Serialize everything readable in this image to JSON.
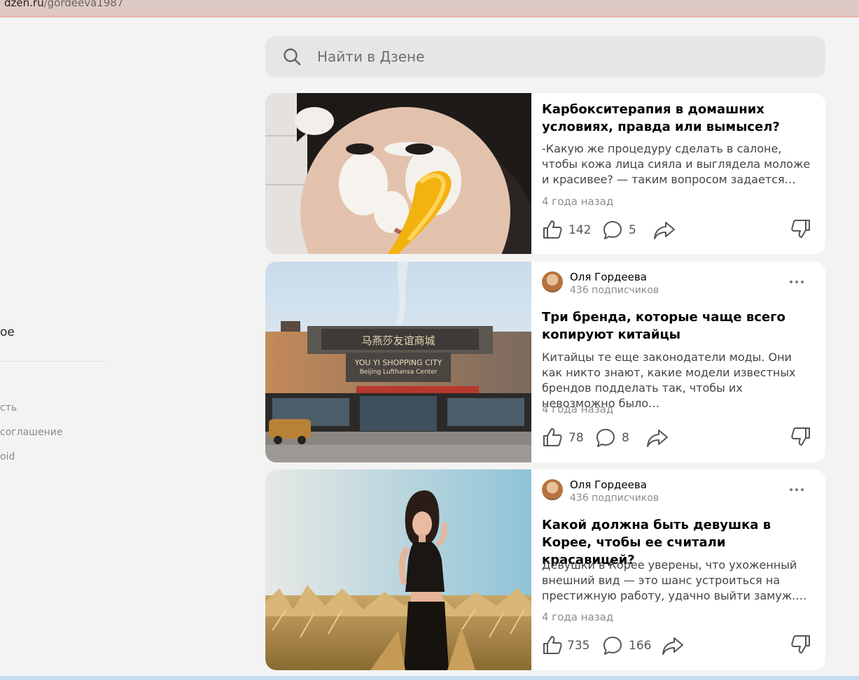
{
  "browser": {
    "url_host": "dzen.ru",
    "url_path": "/gordeeva1987"
  },
  "sidebar": {
    "items": [
      {
        "label": "ое"
      }
    ],
    "footer_links": [
      {
        "label": "сть"
      },
      {
        "label": "соглашение"
      },
      {
        "label": "oid"
      }
    ]
  },
  "search": {
    "placeholder": "Найти в Дзене"
  },
  "feed": [
    {
      "title": "Карбокситерапия в домашних условиях, правда или вымысел?",
      "snippet": "-Какую же процедуру сделать в салоне, чтобы кожа лица сияла и выглядела моложе и красивее? — таким вопросом задается…",
      "date": "4 года назад",
      "likes": "142",
      "comments": "5"
    },
    {
      "author": "Оля Гордеева",
      "subscribers": "436 подписчиков",
      "title": "Три бренда, которые чаще всего копируют китайцы",
      "snippet": "Китайцы те еще законодатели моды. Они как никто знают, какие модели известных брендов подделать так, чтобы их невозможно было…",
      "date": "4 года назад",
      "likes": "78",
      "comments": "8",
      "image_sign": "YOU YI SHOPPING CITY",
      "image_sign_sub": "Beijing Lufthansa Center"
    },
    {
      "author": "Оля Гордеева",
      "subscribers": "436 подписчиков",
      "title": "Какой должна быть девушка в Корее, чтобы ее считали красавицей?",
      "snippet": "Девушки в Корее уверены, что ухоженный внешний вид — это шанс устроиться на престижную работу, удачно выйти замуж.…",
      "date": "4 года назад",
      "likes": "735",
      "comments": "166"
    }
  ]
}
